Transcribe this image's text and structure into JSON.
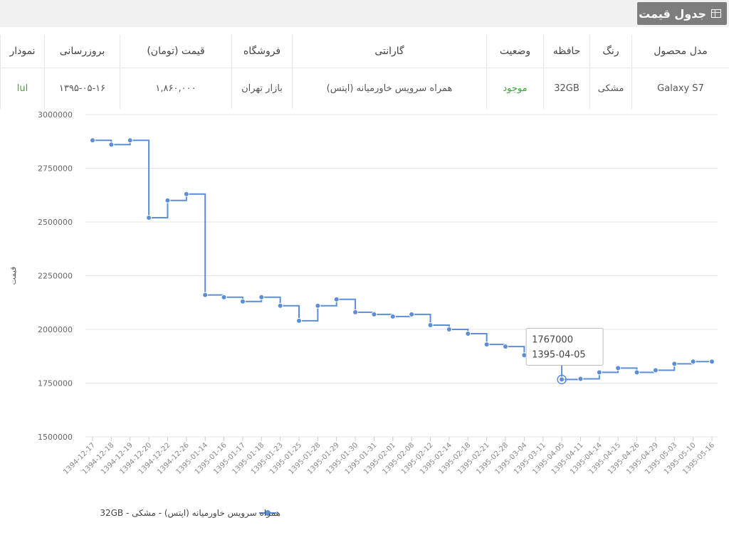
{
  "header": {
    "title": "جدول قیمت",
    "icon": "table-icon"
  },
  "table": {
    "columns": [
      "مدل محصول",
      "رنگ",
      "حافظه",
      "وضعیت",
      "گارانتی",
      "فروشگاه",
      "قیمت (تومان)",
      "بروزرسانی",
      "نمودار"
    ],
    "row": [
      "Galaxy S7",
      "مشکی",
      "32GB",
      "موجود",
      "همراه سرویس خاورمیانه (اپتس)",
      "بازار تهران",
      "۱,۸۶۰,۰۰۰",
      "۱۳۹۵-۰۵-۱۶",
      "lul"
    ],
    "status_color": "#3aa63a"
  },
  "chart_data": {
    "type": "line",
    "step": true,
    "ylabel": "قیمت",
    "ylim": [
      1500000,
      3000000
    ],
    "yticks": [
      "3000000",
      "2750000",
      "2500000",
      "2250000",
      "2000000",
      "1750000",
      "1500000"
    ],
    "x": [
      "1394-12-17",
      "1394-12-18",
      "1394-12-19",
      "1394-12-20",
      "1394-12-22",
      "1394-12-26",
      "1395-01-14",
      "1395-01-16",
      "1395-01-17",
      "1395-01-18",
      "1395-01-23",
      "1395-01-25",
      "1395-01-28",
      "1395-01-29",
      "1395-01-30",
      "1395-01-31",
      "1395-02-01",
      "1395-02-08",
      "1395-02-12",
      "1395-02-14",
      "1395-02-18",
      "1395-02-21",
      "1395-02-28",
      "1395-03-04",
      "1395-03-11",
      "1395-04-05",
      "1395-04-11",
      "1395-04-14",
      "1395-04-15",
      "1395-04-26",
      "1395-04-29",
      "1395-05-03",
      "1395-05-10",
      "1395-05-16"
    ],
    "series": [
      {
        "name": "همراه سرویس خاورمیانه (اپتس) - مشکی - 32GB",
        "color": "#5b8ed6",
        "values": [
          2880000,
          2860000,
          2880000,
          2520000,
          2600000,
          2630000,
          2160000,
          2150000,
          2130000,
          2150000,
          2110000,
          2040000,
          2110000,
          2140000,
          2080000,
          2070000,
          2060000,
          2070000,
          2020000,
          2000000,
          1980000,
          1930000,
          1920000,
          1880000,
          1880000,
          1767000,
          1770000,
          1800000,
          1820000,
          1800000,
          1810000,
          1840000,
          1850000,
          1850000
        ]
      }
    ],
    "tooltip": {
      "value": "1767000",
      "date": "1395-04-05"
    },
    "legend": "bottom-center",
    "grid": true
  }
}
